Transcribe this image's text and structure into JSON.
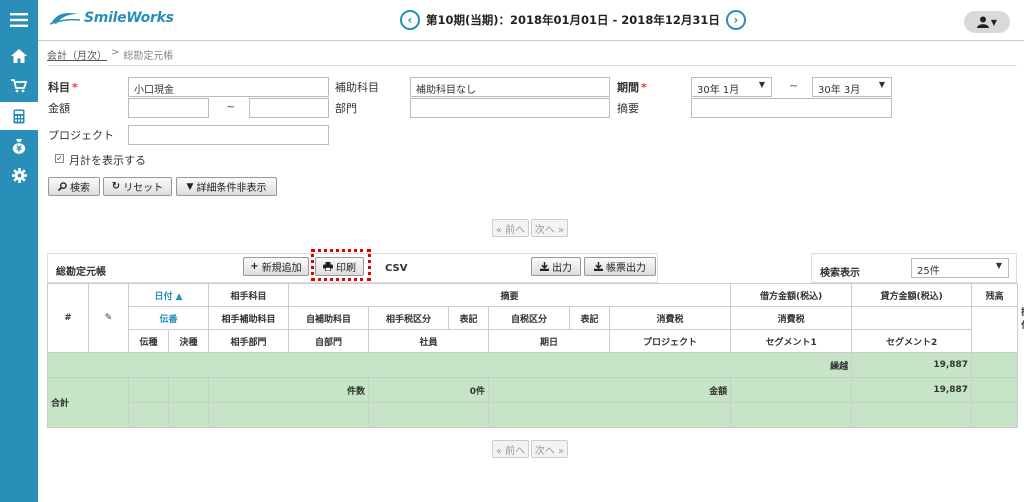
{
  "header": {
    "logo": "SmileWorks",
    "period": "第10期(当期)：2018年01月01日 - 2018年12月31日",
    "prev_icon": "chevron-left-icon",
    "next_icon": "chevron-right-icon",
    "user_icon": "user-icon"
  },
  "sidebar": {
    "items": [
      {
        "icon": "menu-icon"
      },
      {
        "icon": "home-icon"
      },
      {
        "icon": "cart-icon"
      },
      {
        "icon": "calculator-icon"
      },
      {
        "icon": "money-bag-icon"
      },
      {
        "icon": "gear-icon"
      }
    ]
  },
  "breadcrumb": {
    "root": "会計（月次）",
    "sep": ">",
    "current": "総勘定元帳"
  },
  "form": {
    "account_label": "科目",
    "account_value": "小口現金",
    "sub_account_label": "補助科目",
    "sub_account_value": "補助科目なし",
    "period_label": "期間",
    "period_from": "30年 1月",
    "period_to": "30年 3月",
    "tilde": "~",
    "amount_label": "金額",
    "department_label": "部門",
    "summary_label": "摘要",
    "project_label": "プロジェクト",
    "show_monthly_label": "月計を表示する",
    "show_monthly_checked": true,
    "search_button": "検索",
    "reset_button": "リセット",
    "toggle_button": "詳細条件非表示"
  },
  "pager": {
    "prev": "« 前へ",
    "next": "次へ »"
  },
  "section": {
    "title": "総勘定元帳",
    "new_button": "新規追加",
    "print_button": "印刷",
    "csv_label": "CSV",
    "output_button": "出力",
    "form_output_button": "帳票出力",
    "display_label": "検索表示",
    "display_value": "25件"
  },
  "table": {
    "col_no": "#",
    "col_edit_icon": "edit-icon",
    "date": "日付 ▲",
    "slip_no": "伝番",
    "slip": "伝種",
    "settle": "決種",
    "counter_account": "相手科目",
    "counter_sub": "相手補助科目",
    "counter_dept": "相手部門",
    "summary": "摘要",
    "own_sub": "自補助科目",
    "own_dept": "自部門",
    "counter_tax": "相手税区分",
    "notation1": "表記",
    "employee": "社員",
    "own_tax": "自税区分",
    "notation2": "表記",
    "due_date": "期日",
    "debit": "借方金額(税込)",
    "credit": "貸方金額(税込)",
    "tax1": "消費税",
    "tax2": "消費税",
    "project": "プロジェクト",
    "segment1": "セグメント1",
    "balance": "残高",
    "segment2": "セグメント2",
    "ops": "操作",
    "carry_label": "繰越",
    "carry_value": "19,887",
    "total_label": "合計",
    "count_label": "件数",
    "count_value": "0件",
    "amount_label": "金額",
    "total_value": "19,887"
  }
}
